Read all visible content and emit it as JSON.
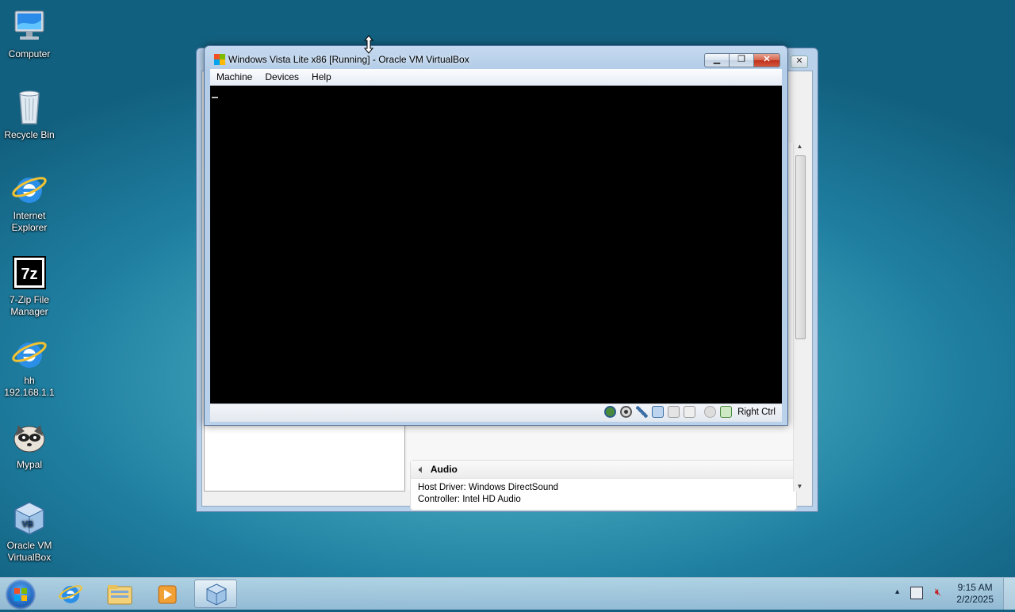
{
  "desktop": {
    "icons": [
      {
        "label": "Computer",
        "icon": "computer-icon"
      },
      {
        "label": "Recycle Bin",
        "icon": "recycle-bin-icon"
      },
      {
        "label": "Internet Explorer",
        "icon": "internet-explorer-icon"
      },
      {
        "label": "7-Zip File Manager",
        "icon": "7zip-icon"
      },
      {
        "label": "hh 192.168.1.1",
        "icon": "internet-explorer-icon"
      },
      {
        "label": "Mypal",
        "icon": "mypal-icon"
      },
      {
        "label": "Oracle VM VirtualBox",
        "icon": "virtualbox-icon"
      }
    ]
  },
  "manager": {
    "close_label": "✕",
    "audio": {
      "title": "Audio",
      "host_driver": "Host Driver: Windows DirectSound",
      "controller": "Controller:   Intel HD Audio"
    }
  },
  "vm_window": {
    "title": "Windows Vista Lite x86 [Running] - Oracle VM VirtualBox",
    "menu": [
      "Machine",
      "Devices",
      "Help"
    ],
    "host_key": "Right Ctrl",
    "status_icons": [
      "hard-disk-icon",
      "optical-drive-icon",
      "usb-icon",
      "network-icon",
      "shared-folder-icon",
      "display-icon",
      "mouse-integration-icon",
      "host-key-icon"
    ]
  },
  "taskbar": {
    "items": [
      "internet-explorer-icon",
      "file-explorer-icon",
      "media-player-icon",
      "virtualbox-icon"
    ],
    "time": "9:15 AM",
    "date": "2/2/2025"
  },
  "colors": {
    "accent": "#1f7ea0",
    "vm_screen": "#000000"
  }
}
